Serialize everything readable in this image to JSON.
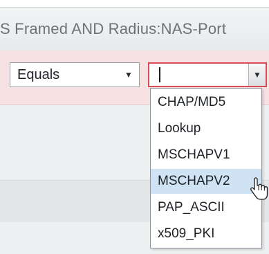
{
  "condition": {
    "expression": "S Framed AND Radius:NAS-Port"
  },
  "operator_select": {
    "value": "Equals",
    "caret_icon": "chevron-down-icon"
  },
  "value_select": {
    "value": "",
    "caret_icon": "chevron-down-icon"
  },
  "dropdown": {
    "options": [
      {
        "label": "CHAP/MD5"
      },
      {
        "label": "Lookup"
      },
      {
        "label": "MSCHAPV1"
      },
      {
        "label": "MSCHAPV2"
      },
      {
        "label": "PAP_ASCII"
      },
      {
        "label": "x509_PKI"
      }
    ],
    "hovered_option": "MSCHAPV2"
  },
  "cursor": {
    "icon": "hand-pointer-icon"
  },
  "colors": {
    "highlight_row": "#f6e1e3",
    "error_border": "#d84a54",
    "hover_option": "#cfe3f5"
  }
}
